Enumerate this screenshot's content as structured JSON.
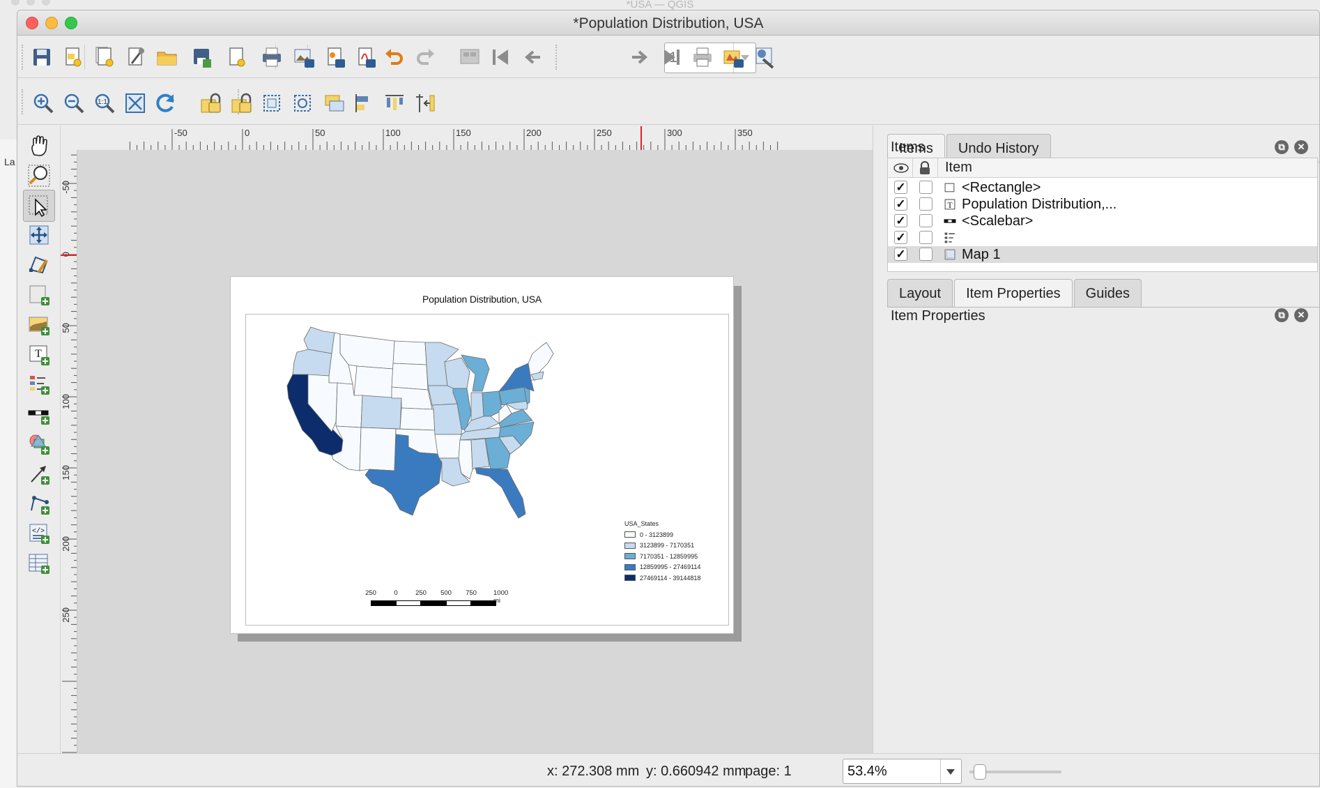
{
  "background_window": {
    "title": "*USA — QGIS",
    "left_strip_labels": [
      "La"
    ]
  },
  "window": {
    "title": "*Population Distribution, USA"
  },
  "toolbar": {
    "page_number": "1",
    "top_icons": [
      "save-layout-icon",
      "new-layout-icon",
      "duplicate-layout-icon",
      "layout-manager-icon",
      "open-template-icon",
      "save-template-icon",
      "page-setup-icon",
      "print-icon",
      "export-image-icon",
      "export-svg-icon",
      "export-pdf-icon",
      "undo-icon",
      "redo-icon",
      "atlas-preview-icon",
      "first-feature-icon",
      "previous-feature-icon",
      "next-feature-icon",
      "last-feature-icon",
      "print-atlas-icon",
      "export-atlas-icon",
      "atlas-settings-icon"
    ],
    "nav_icons": [
      "zoom-in-icon",
      "zoom-out-icon",
      "zoom-actual-icon",
      "zoom-full-icon",
      "refresh-icon",
      "lock-items-icon",
      "unlock-items-icon",
      "select-all-icon",
      "deselect-icon",
      "raise-items-icon",
      "align-items-icon",
      "distribute-items-icon",
      "resize-items-icon"
    ]
  },
  "tools": [
    "pan-icon",
    "zoom-tool-icon",
    "select-move-icon",
    "move-content-icon",
    "edit-nodes-icon",
    "add-map-icon",
    "add-picture-icon",
    "add-label-icon",
    "add-legend-icon",
    "add-scalebar-icon",
    "add-shape-icon",
    "add-arrow-icon",
    "add-node-item-icon",
    "add-html-icon",
    "add-attribute-table-icon"
  ],
  "ruler": {
    "h_labels": [
      "-50",
      "0",
      "50",
      "100",
      "150",
      "200",
      "250",
      "300",
      "350"
    ],
    "v_labels": [
      "-50",
      "0",
      "50",
      "100",
      "150",
      "200",
      "250"
    ]
  },
  "map": {
    "title": "Population Distribution, USA",
    "legend": {
      "title": "USA_States",
      "classes": [
        {
          "label": "0 - 3123899",
          "color": "#f7fbff"
        },
        {
          "label": "3123899 - 7170351",
          "color": "#c6dbef"
        },
        {
          "label": "7170351 - 12859995",
          "color": "#6baed6"
        },
        {
          "label": "12859995 - 27469114",
          "color": "#3a7bbf"
        },
        {
          "label": "27469114 - 39144818",
          "color": "#0c2c6c"
        }
      ]
    },
    "scalebar": {
      "labels": [
        "250",
        "0",
        "250",
        "500",
        "750",
        "1000 mi"
      ]
    }
  },
  "right_panel": {
    "tabs_top": [
      "Items",
      "Undo History"
    ],
    "items_dock_title": "Items",
    "items_header": "Item",
    "items": [
      {
        "label": "<Rectangle>",
        "icon": "rectangle-icon",
        "visible": true,
        "locked": false
      },
      {
        "label": "Population Distribution,...",
        "icon": "label-item-icon",
        "visible": true,
        "locked": false
      },
      {
        "label": "<Scalebar>",
        "icon": "scalebar-item-icon",
        "visible": true,
        "locked": false
      },
      {
        "label": "",
        "icon": "legend-item-icon",
        "visible": true,
        "locked": false
      },
      {
        "label": "Map 1",
        "icon": "map-item-icon",
        "visible": true,
        "locked": false,
        "selected": true
      }
    ],
    "check_mark": "✓",
    "tabs_bottom": [
      "Layout",
      "Item Properties",
      "Guides"
    ],
    "properties_dock_title": "Item Properties"
  },
  "status": {
    "x": "x: 272.308 mm",
    "y": "y: 0.660942 mm",
    "page": "page: 1",
    "zoom": "53.4%"
  }
}
